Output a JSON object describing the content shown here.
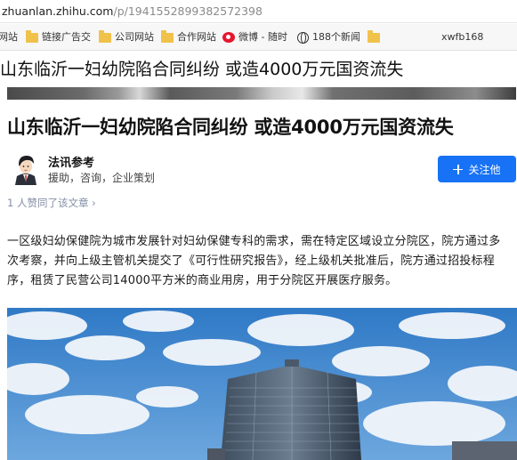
{
  "browser": {
    "url_host": "zhuanlan.zhihu.com",
    "url_path": "/p/1941552899382572398"
  },
  "bookmarks": {
    "items": [
      {
        "label": "网站",
        "icon": "none"
      },
      {
        "label": "链接广告交",
        "icon": "folder-icon"
      },
      {
        "label": "公司网站",
        "icon": "folder-icon"
      },
      {
        "label": "合作网站",
        "icon": "folder-icon"
      },
      {
        "label": "微博 - 随时",
        "icon": "weibo-icon"
      },
      {
        "label": "188个新闻",
        "icon": "globe-icon"
      },
      {
        "label": "",
        "icon": "folder-icon"
      },
      {
        "label": "xwfb168",
        "icon": "none"
      }
    ]
  },
  "page": {
    "window_title": "山东临沂一妇幼院陷合同纠纷 或造4000万元国资流失"
  },
  "article": {
    "title": "山东临沂一妇幼院陷合同纠纷 或造4000万元国资流失",
    "author": {
      "name": "法讯参考",
      "bio": "援助，咨询，企业策划"
    },
    "follow_label": "关注他",
    "likes_text": "1 人赞同了该文章",
    "likes_chevron": "›",
    "paragraph": "一区级妇幼保健院为城市发展针对妇幼保健专科的需求，需在特定区域设立分院区，院方通过多次考察，并向上级主管机关提交了《可行性研究报告》，经上级机关批准后，院方通过招投标程序，租赁了民营公司14000平方米的商业用房，用于分院区开展医疗服务。"
  },
  "colors": {
    "accent": "#1772f6",
    "folder": "#f0c24b",
    "muted": "#8590a6"
  }
}
